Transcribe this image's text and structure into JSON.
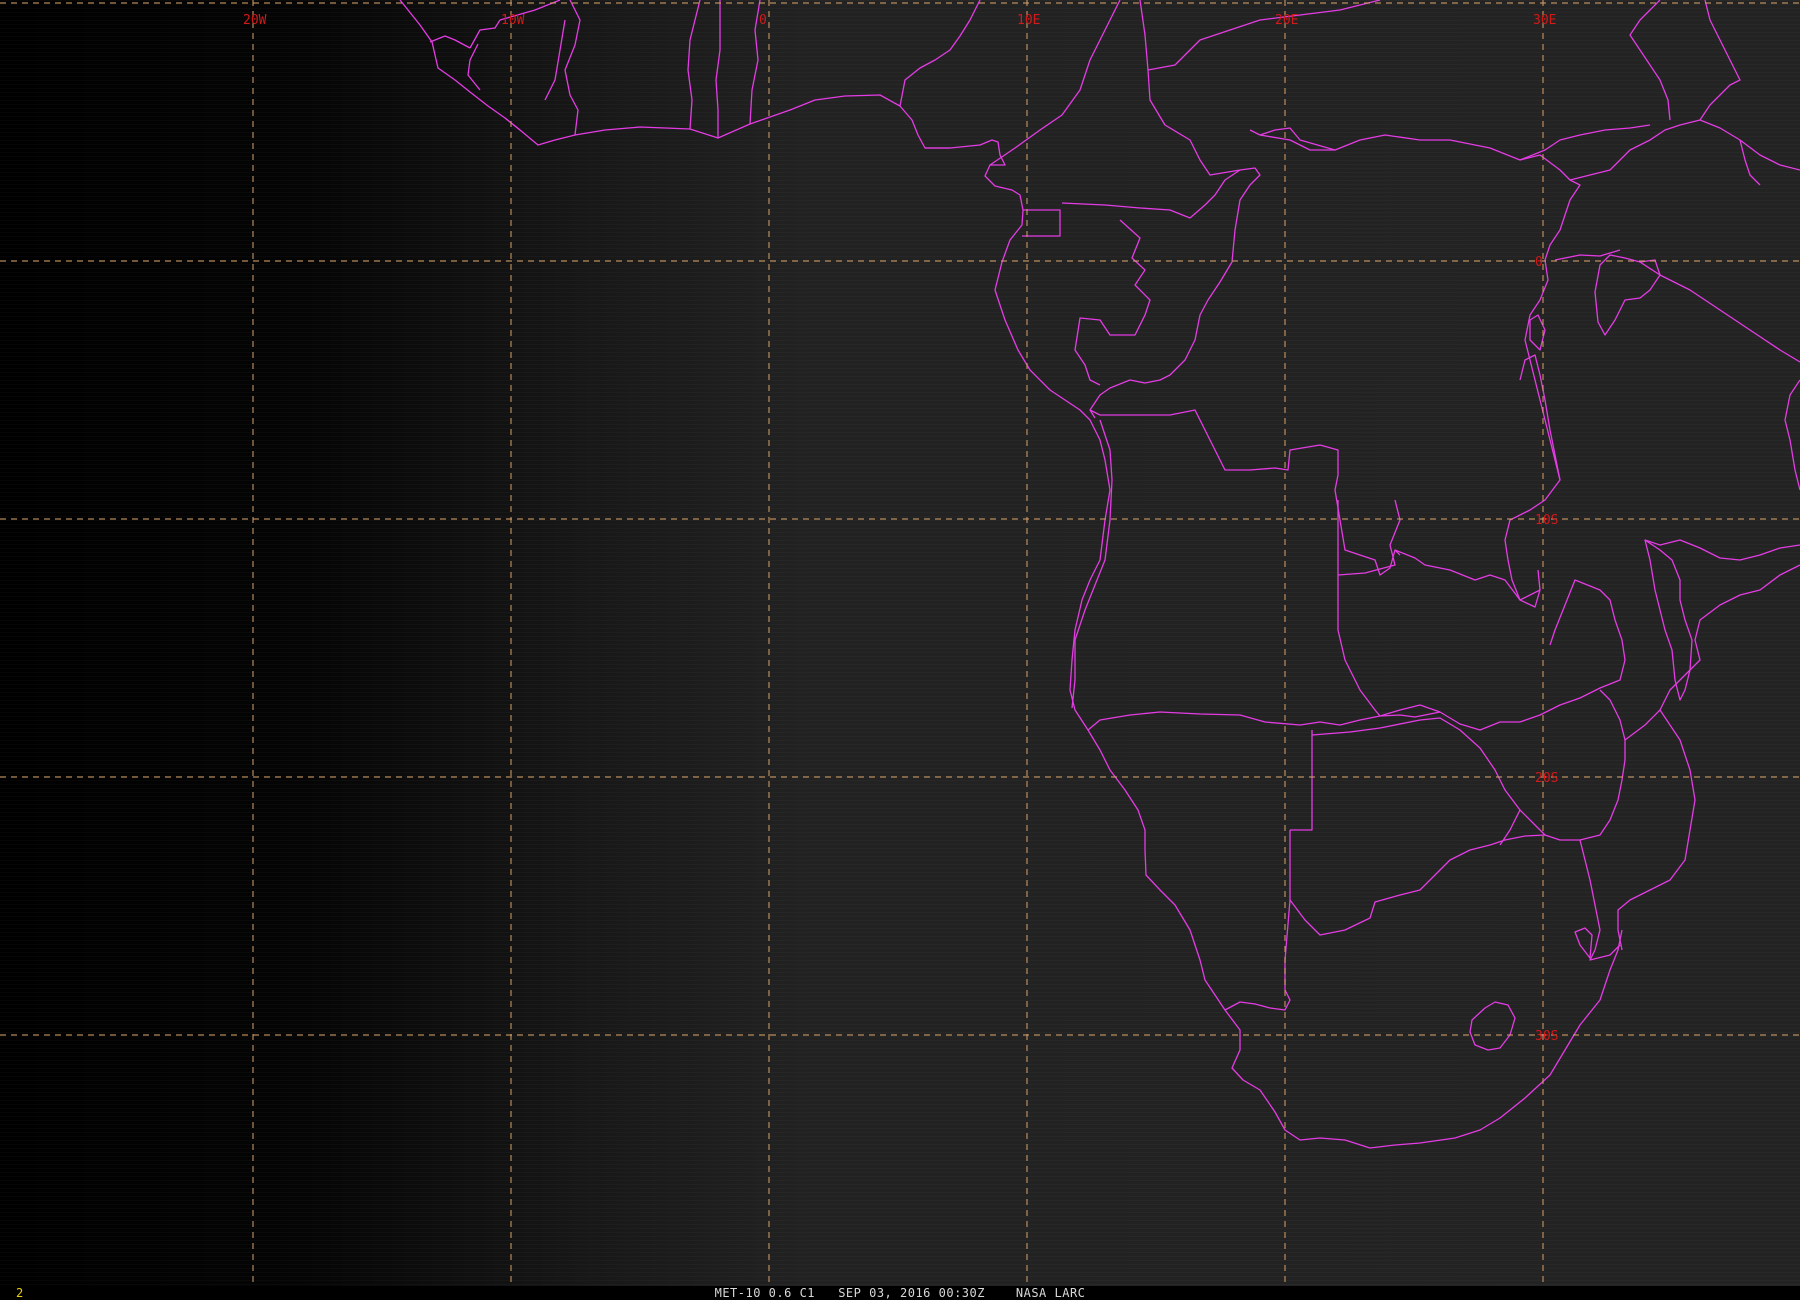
{
  "overlay_colors": {
    "grid": "#d4a06a",
    "grid_label": "#d21a1a",
    "borders": "#e43ce4",
    "frame_number": "#e8d000",
    "caption": "#d8d8d8"
  },
  "grid": {
    "longitudes": [
      {
        "value": -20,
        "label": "20W"
      },
      {
        "value": -10,
        "label": "10W"
      },
      {
        "value": 0,
        "label": "0"
      },
      {
        "value": 10,
        "label": "10E"
      },
      {
        "value": 20,
        "label": "20E"
      },
      {
        "value": 30,
        "label": "30E"
      }
    ],
    "latitudes": [
      {
        "value": 0,
        "label": "0"
      },
      {
        "value": -10,
        "label": "10S"
      },
      {
        "value": -20,
        "label": "20S"
      },
      {
        "value": -30,
        "label": "30S"
      }
    ]
  },
  "status_bar": {
    "frame_number": "2",
    "caption": "MET-10 0.6 C1   SEP 03, 2016 00:30Z    NASA LARC"
  }
}
